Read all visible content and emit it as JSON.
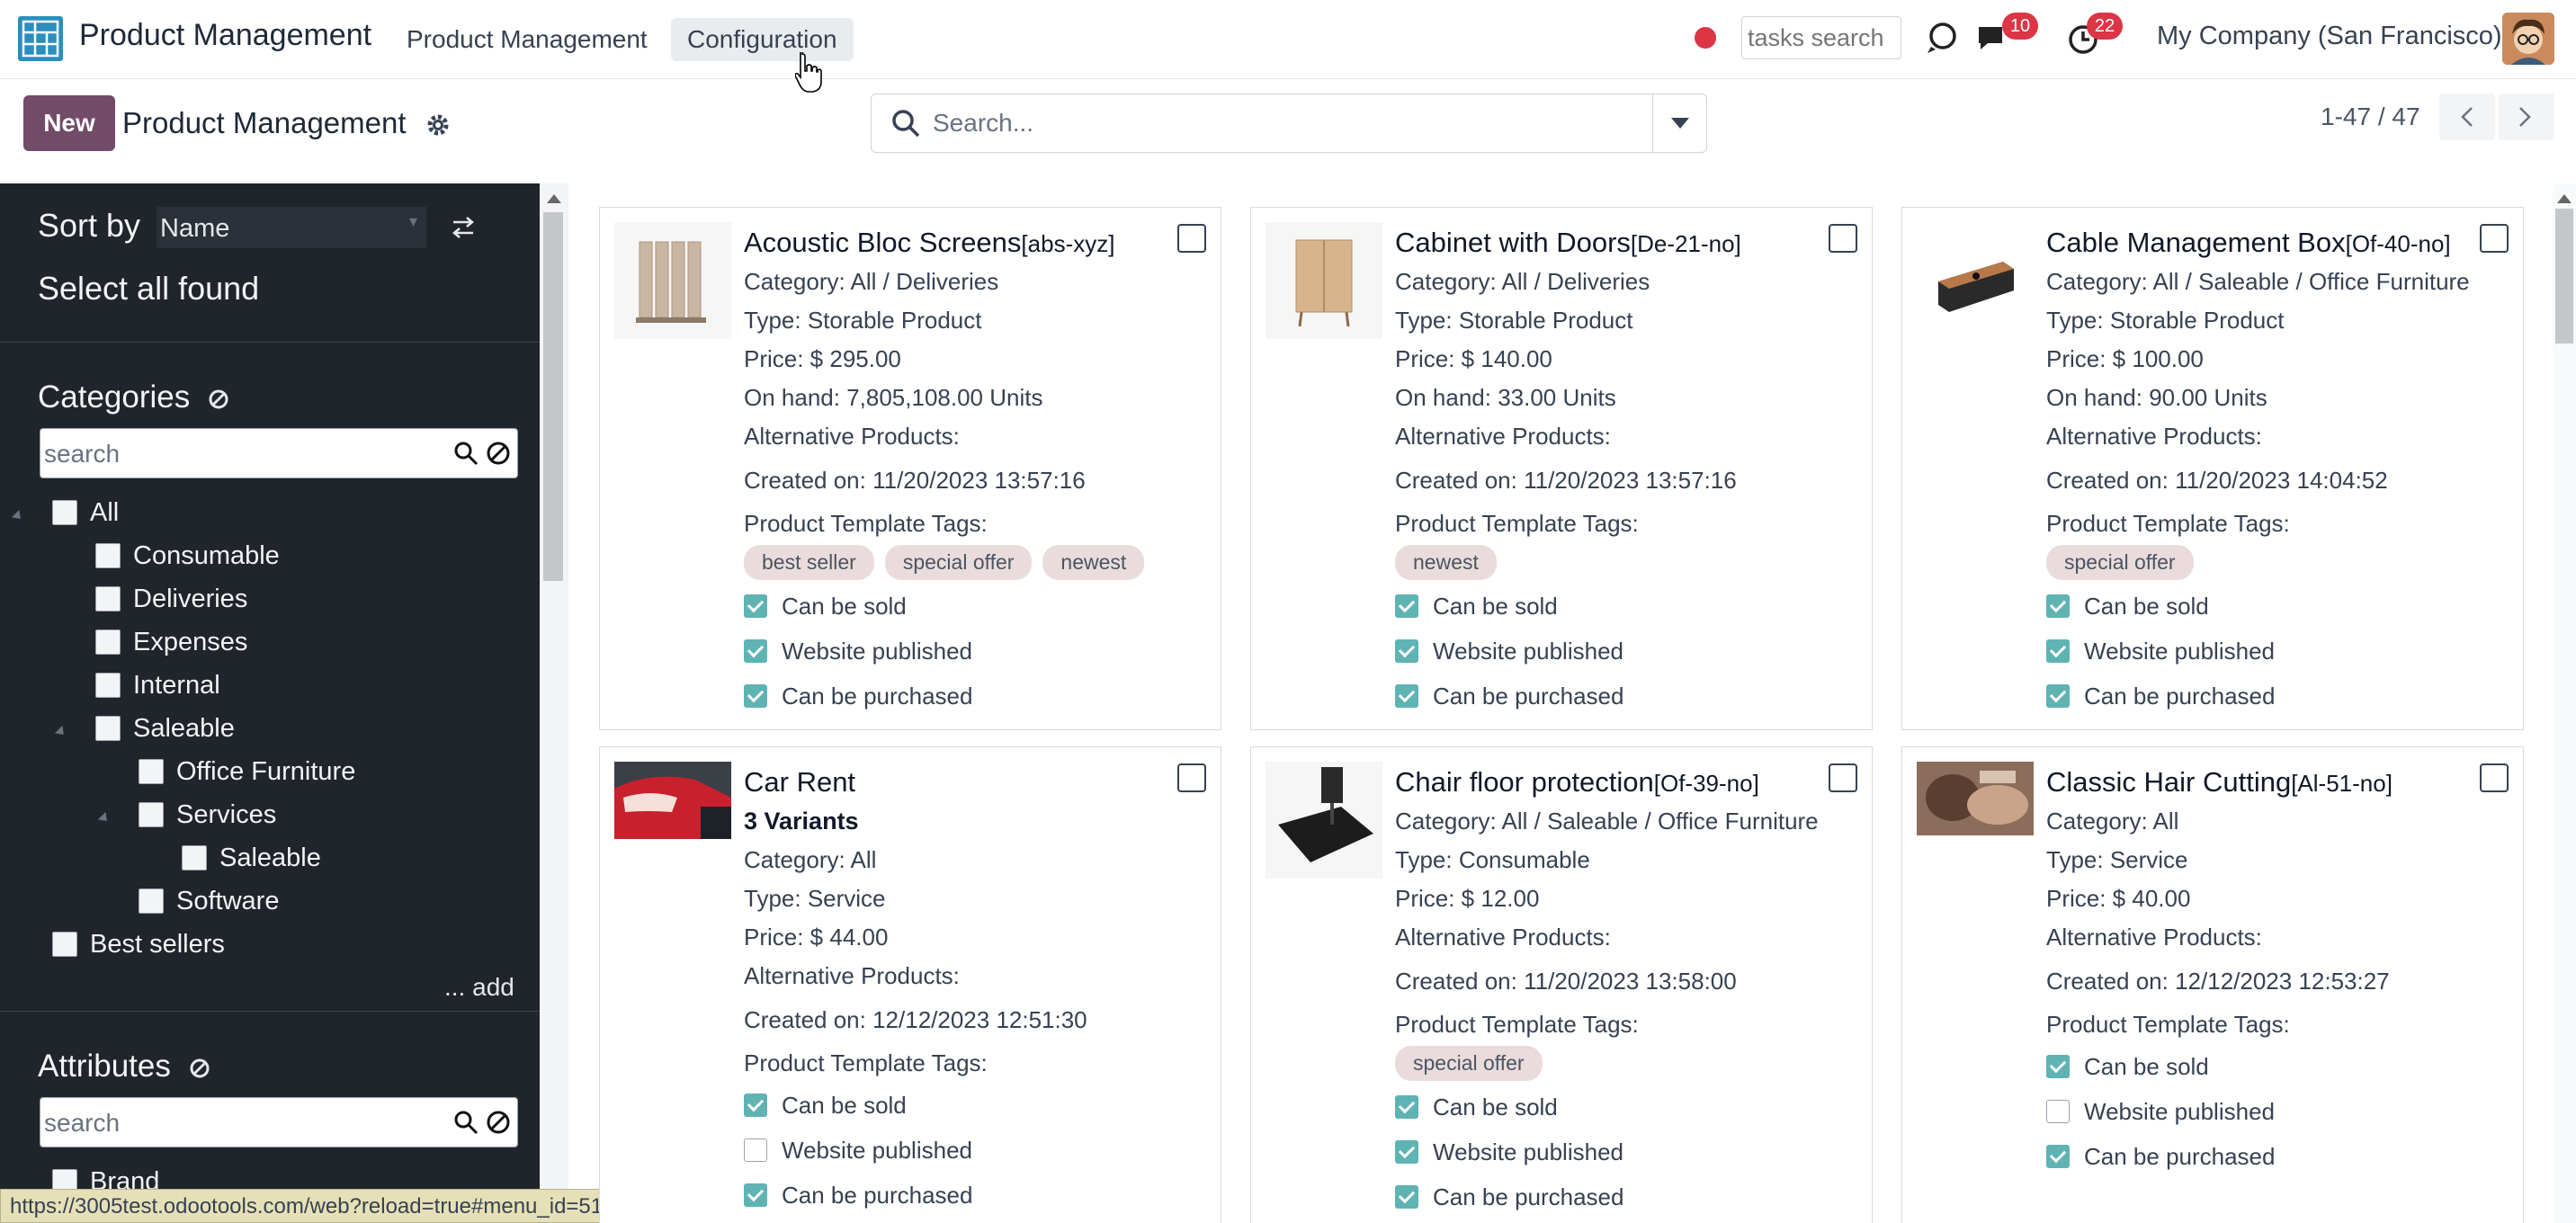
{
  "topbar": {
    "app_name": "Product Management",
    "menus": [
      "Product Management",
      "Configuration"
    ],
    "tasks_search_placeholder": "tasks search",
    "messages_count": "10",
    "activities_count": "22",
    "company": "My Company (San Francisco)"
  },
  "control_panel": {
    "new_label": "New",
    "breadcrumb": "Product Management",
    "search_placeholder": "Search...",
    "pager": "1-47 / 47"
  },
  "sidebar": {
    "sort_by_label": "Sort by",
    "sort_value": "Name",
    "select_all": "Select all found",
    "categories_heading": "Categories",
    "categories_search_placeholder": "search",
    "categories": [
      {
        "label": "All"
      },
      {
        "label": "Consumable"
      },
      {
        "label": "Deliveries"
      },
      {
        "label": "Expenses"
      },
      {
        "label": "Internal"
      },
      {
        "label": "Saleable"
      },
      {
        "label": "Office Furniture"
      },
      {
        "label": "Services"
      },
      {
        "label": "Saleable"
      },
      {
        "label": "Software"
      },
      {
        "label": "Best sellers"
      }
    ],
    "add_label": "... add",
    "attributes_heading": "Attributes",
    "attributes_search_placeholder": "search",
    "attributes": [
      {
        "label": "Brand"
      }
    ]
  },
  "status_url": "https://3005test.odootools.com/web?reload=true#menu_id=510&action=752",
  "labels": {
    "alternative_products": "Alternative Products:",
    "template_tags": "Product Template Tags:",
    "can_be_sold": "Can be sold",
    "website_published": "Website published",
    "can_be_purchased": "Can be purchased"
  },
  "cards": [
    {
      "name": "Acoustic Bloc Screens",
      "code": "[abs-xyz]",
      "category": "Category: All / Deliveries",
      "type": "Type: Storable Product",
      "price": "Price: $ 295.00",
      "on_hand": "On hand: 7,805,108.00 Units",
      "created": "Created on: 11/20/2023 13:57:16",
      "tags": [
        "best seller",
        "special offer",
        "newest"
      ],
      "sold": true,
      "published": true,
      "purchased": true
    },
    {
      "name": "Cabinet with Doors",
      "code": "[De-21-no]",
      "category": "Category: All / Deliveries",
      "type": "Type: Storable Product",
      "price": "Price: $ 140.00",
      "on_hand": "On hand: 33.00 Units",
      "created": "Created on: 11/20/2023 13:57:16",
      "tags": [
        "newest"
      ],
      "sold": true,
      "published": true,
      "purchased": true
    },
    {
      "name": "Cable Management Box",
      "code": "[Of-40-no]",
      "category": "Category: All / Saleable / Office Furniture",
      "type": "Type: Storable Product",
      "price": "Price: $ 100.00",
      "on_hand": "On hand: 90.00 Units",
      "created": "Created on: 11/20/2023 14:04:52",
      "tags": [
        "special offer"
      ],
      "sold": true,
      "published": true,
      "purchased": true
    },
    {
      "name": "Car Rent",
      "code": "",
      "variants": "3 Variants",
      "category": "Category: All",
      "type": "Type: Service",
      "price": "Price: $ 44.00",
      "created": "Created on: 12/12/2023 12:51:30",
      "tags": [],
      "sold": true,
      "published": false,
      "purchased": true
    },
    {
      "name": "Chair floor protection",
      "code": "[Of-39-no]",
      "category": "Category: All / Saleable / Office Furniture",
      "type": "Type: Consumable",
      "price": "Price: $ 12.00",
      "created": "Created on: 11/20/2023 13:58:00",
      "tags": [
        "special offer"
      ],
      "sold": true,
      "published": true,
      "purchased": true
    },
    {
      "name": "Classic Hair Cutting",
      "code": "[Al-51-no]",
      "category": "Category: All",
      "type": "Type: Service",
      "price": "Price: $ 40.00",
      "created": "Created on: 12/12/2023 12:53:27",
      "tags": [],
      "sold": true,
      "published": false,
      "purchased": true
    }
  ]
}
